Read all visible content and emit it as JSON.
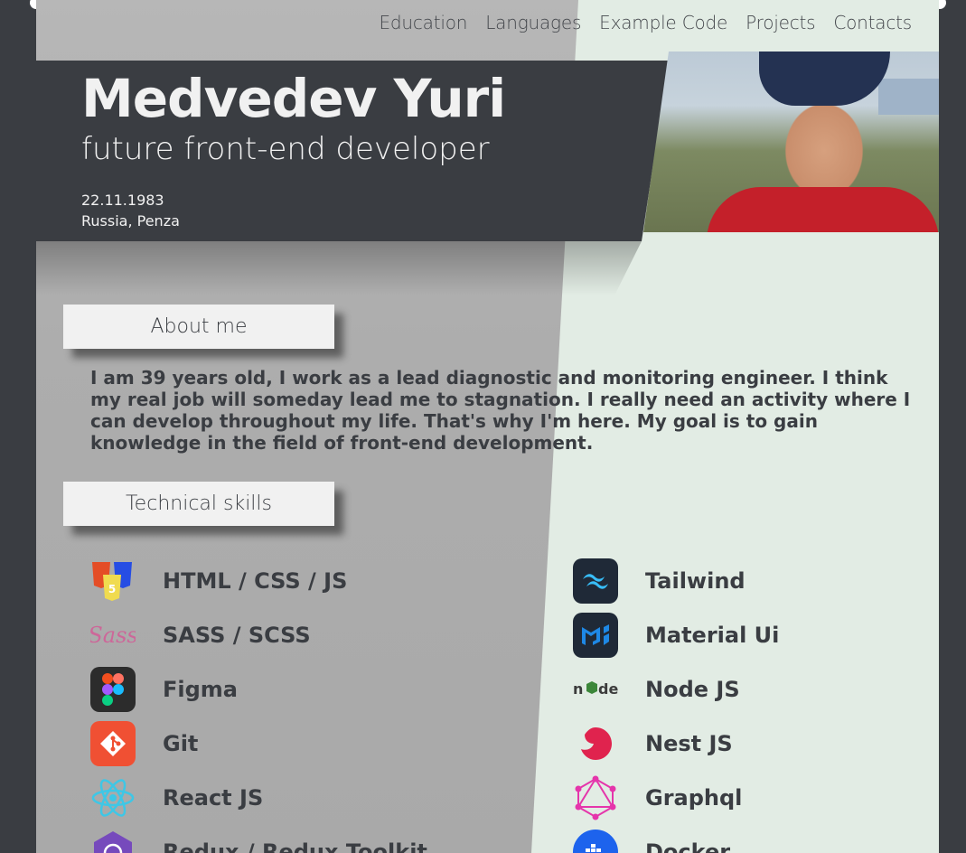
{
  "nav": {
    "items": [
      "Education",
      "Languages",
      "Example Code",
      "Projects",
      "Contacts"
    ]
  },
  "header": {
    "name": "Medvedev Yuri",
    "role": "future front-end developer",
    "birthdate": "22.11.1983",
    "location": "Russia, Penza"
  },
  "about": {
    "title": "About me",
    "text": "I am 39 years old, I work as a lead diagnostic and monitoring engineer. I think my real job will someday lead me to stagnation. I really need an activity where I can develop throughout my life. That's why I'm here. My goal is to gain knowledge in the field of front-end development."
  },
  "skills": {
    "title": "Technical skills",
    "left": [
      {
        "label": "HTML / CSS / JS",
        "icon": "html-css-js-icon"
      },
      {
        "label": "SASS / SCSS",
        "icon": "sass-icon"
      },
      {
        "label": "Figma",
        "icon": "figma-icon"
      },
      {
        "label": "Git",
        "icon": "git-icon"
      },
      {
        "label": "React JS",
        "icon": "react-icon"
      },
      {
        "label": "Redux / Redux Toolkit",
        "icon": "redux-icon"
      }
    ],
    "right": [
      {
        "label": "Tailwind",
        "icon": "tailwind-icon"
      },
      {
        "label": "Material Ui",
        "icon": "material-ui-icon"
      },
      {
        "label": "Node JS",
        "icon": "nodejs-icon"
      },
      {
        "label": "Nest JS",
        "icon": "nestjs-icon"
      },
      {
        "label": "Graphql",
        "icon": "graphql-icon"
      },
      {
        "label": "Docker",
        "icon": "docker-icon"
      }
    ]
  },
  "colors": {
    "dark": "#3a3d42",
    "light_panel": "#e2ece4",
    "gray_panel": "#adadad",
    "tab_bg": "#f1f1f1"
  }
}
